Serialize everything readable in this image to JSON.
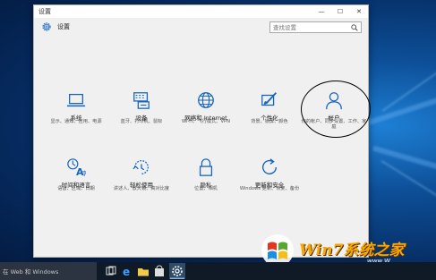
{
  "window": {
    "title": "设置",
    "header_title": "设置",
    "search_placeholder": "查找设置",
    "controls": {
      "minimize": "—",
      "maximize": "☐",
      "close": "✕"
    }
  },
  "tiles": [
    {
      "icon": "laptop-icon",
      "title": "系统",
      "desc": "显示、通知、应用、电源"
    },
    {
      "icon": "keyboard-printer-icon",
      "title": "设备",
      "desc": "蓝牙、打印机、鼠标"
    },
    {
      "icon": "globe-icon",
      "title": "网络和 Internet",
      "desc": "Wi-Fi、飞行模式、VPN"
    },
    {
      "icon": "paint-icon",
      "title": "个性化",
      "desc": "背景、锁屏、颜色"
    },
    {
      "icon": "person-icon",
      "title": "帐户",
      "desc": "你的帐户、同步设置、工作、家庭"
    },
    {
      "icon": "time-language-icon",
      "title": "时间和语言",
      "desc": "语音、区域、日期"
    },
    {
      "icon": "accessibility-icon",
      "title": "轻松使用",
      "desc": "讲述人、放大镜、高对比度"
    },
    {
      "icon": "lock-icon",
      "title": "隐私",
      "desc": "位置、相机"
    },
    {
      "icon": "update-icon",
      "title": "更新和安全",
      "desc": "Windows 更新、恢复、备份"
    }
  ],
  "taskbar": {
    "search_text": "在 Web 和 Windows",
    "icons": [
      "task-view-icon",
      "edge-icon",
      "file-explorer-icon",
      "store-icon",
      "settings-icon"
    ]
  },
  "watermark": {
    "text": "Win7系统之家",
    "sub": "www.W"
  },
  "colors": {
    "accent": "#1565c0",
    "window_bg": "#f0f0f0",
    "annotation": "#000000"
  }
}
